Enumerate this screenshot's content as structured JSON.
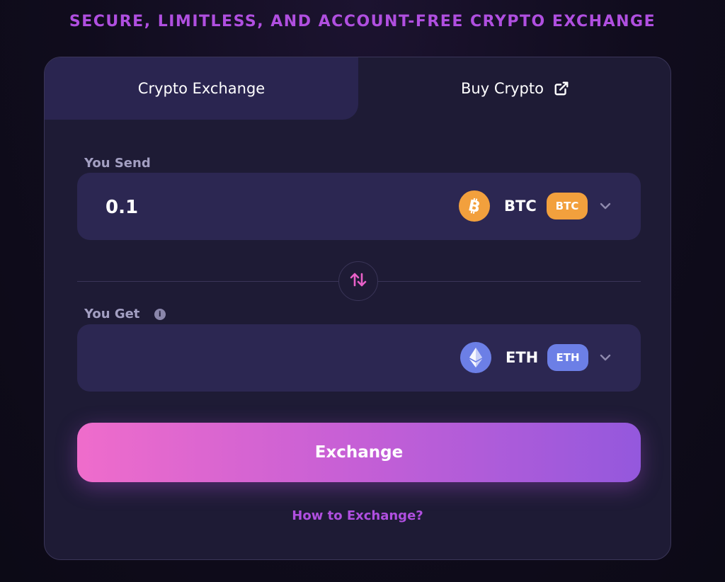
{
  "tagline": "SECURE, LIMITLESS, AND ACCOUNT-FREE CRYPTO EXCHANGE",
  "tabs": {
    "exchange_label": "Crypto Exchange",
    "buy_label": "Buy Crypto",
    "buy_icon": "external-link-icon"
  },
  "send": {
    "label": "You Send",
    "amount": "0.1",
    "ticker": "BTC",
    "badge": "BTC",
    "coin_icon": "bitcoin-icon",
    "coin_color": "#f2a03d"
  },
  "get": {
    "label": "You Get",
    "info_icon": "info-icon",
    "amount": "",
    "ticker": "ETH",
    "badge": "ETH",
    "coin_icon": "ethereum-icon",
    "coin_color": "#6c7fe6"
  },
  "swap_icon": "swap-arrows-icon",
  "exchange_button": "Exchange",
  "help_link": "How to Exchange?",
  "colors": {
    "accent": "#b04fe0",
    "card_bg": "#1e1b35",
    "field_bg": "#2c2752",
    "button_gradient": [
      "#ef6ccb",
      "#9458dd"
    ]
  }
}
